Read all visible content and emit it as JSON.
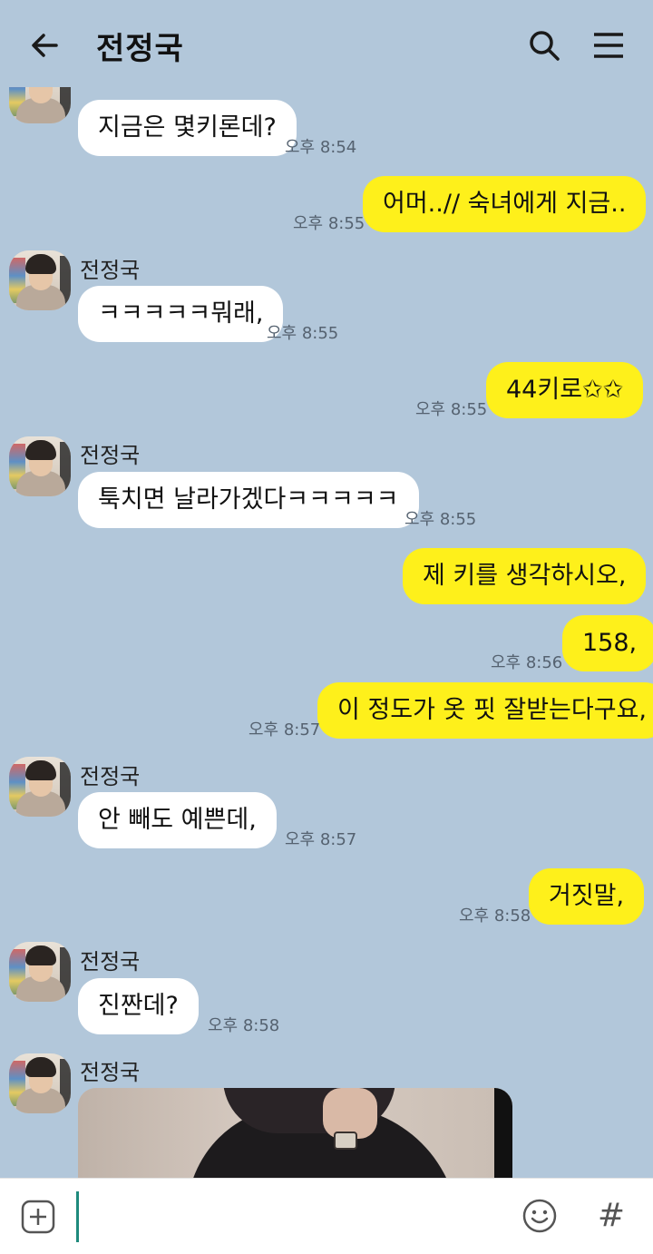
{
  "header": {
    "title": "전정국",
    "back_icon": "arrow-left-icon",
    "search_icon": "search-icon",
    "menu_icon": "hamburger-menu-icon"
  },
  "colors": {
    "background": "#b2c7da",
    "incoming_bubble": "#ffffff",
    "outgoing_bubble": "#fef01b",
    "cursor": "#1e8a7c"
  },
  "messages": [
    {
      "side": "in",
      "text": "지금은 몇키론데?",
      "time": "오후 8:54"
    },
    {
      "side": "out",
      "text": "어머..// 숙녀에게 지금..",
      "time": "오후 8:55"
    },
    {
      "side": "in",
      "sender": "전정국",
      "text": "ㅋㅋㅋㅋㅋ뭐래,",
      "time": "오후 8:55"
    },
    {
      "side": "out",
      "text": "44키로✩✩",
      "time": "오후 8:55"
    },
    {
      "side": "in",
      "sender": "전정국",
      "text": "툭치면 날라가겠다ㅋㅋㅋㅋㅋ",
      "time": "오후 8:55"
    },
    {
      "side": "out",
      "text": "제 키를 생각하시오,"
    },
    {
      "side": "out",
      "text": "158,",
      "time": "오후 8:56"
    },
    {
      "side": "out",
      "text": "이 정도가 옷 핏 잘받는다구요,",
      "time": "오후 8:57"
    },
    {
      "side": "in",
      "sender": "전정국",
      "text": "안 빼도 예쁜데,",
      "time": "오후 8:57"
    },
    {
      "side": "out",
      "text": "거짓말,",
      "time": "오후 8:58"
    },
    {
      "side": "in",
      "sender": "전정국",
      "text": "진짠데?",
      "time": "오후 8:58"
    },
    {
      "side": "in",
      "sender": "전정국",
      "type": "photo"
    }
  ],
  "input_bar": {
    "plus_icon": "plus-square-icon",
    "emoji_icon": "smiley-icon",
    "hash_label": "#",
    "value": ""
  }
}
